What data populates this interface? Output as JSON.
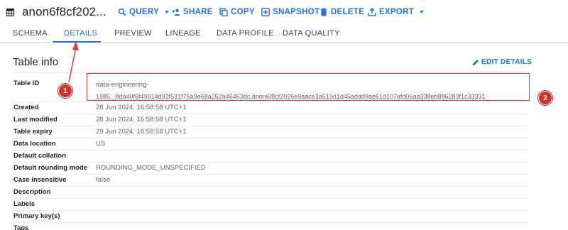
{
  "header": {
    "title": "anon6f8cf202...",
    "icon": "table-icon"
  },
  "toolbar": {
    "query_label": "QUERY",
    "share_label": "SHARE",
    "copy_label": "COPY",
    "snapshot_label": "SNAPSHOT",
    "delete_label": "DELETE",
    "export_label": "EXPORT",
    "accent_color": "#1a73e8"
  },
  "tabs": [
    {
      "label": "SCHEMA",
      "active": false
    },
    {
      "label": "DETAILS",
      "active": true
    },
    {
      "label": "PREVIEW",
      "active": false
    },
    {
      "label": "LINEAGE",
      "active": false
    },
    {
      "label": "DATA PROFILE",
      "active": false
    },
    {
      "label": "DATA QUALITY",
      "active": false
    }
  ],
  "section": {
    "title": "Table info",
    "edit_label": "EDIT DETAILS"
  },
  "table_info": {
    "rows": [
      {
        "key": "Table ID",
        "value_line1": "data-engineering-",
        "value_line2": "1985._8da40f6f49914d92f531f75a9e68a252a46463dc.anon6f8cf2026e9aace3a519d1d45adad9ae61d107afd06aa338eb886283f1c33331"
      },
      {
        "key": "Created",
        "value": "28 Jun 2024, 16:58:58 UTC+1"
      },
      {
        "key": "Last modified",
        "value": "28 Jun 2024, 16:58:58 UTC+1"
      },
      {
        "key": "Table expiry",
        "value": "29 Jun 2024, 16:58:58 UTC+1"
      },
      {
        "key": "Data location",
        "value": "US"
      },
      {
        "key": "Default collation",
        "value": ""
      },
      {
        "key": "Default rounding mode",
        "value": "ROUNDING_MODE_UNSPECIFIED"
      },
      {
        "key": "Case insensitive",
        "value": "false"
      },
      {
        "key": "Description",
        "value": ""
      },
      {
        "key": "Labels",
        "value": ""
      },
      {
        "key": "Primary key(s)",
        "value": ""
      },
      {
        "key": "Tags",
        "value": ""
      }
    ]
  },
  "annotations": {
    "badge_1": "1",
    "badge_2": "2",
    "color": "#d93025"
  }
}
